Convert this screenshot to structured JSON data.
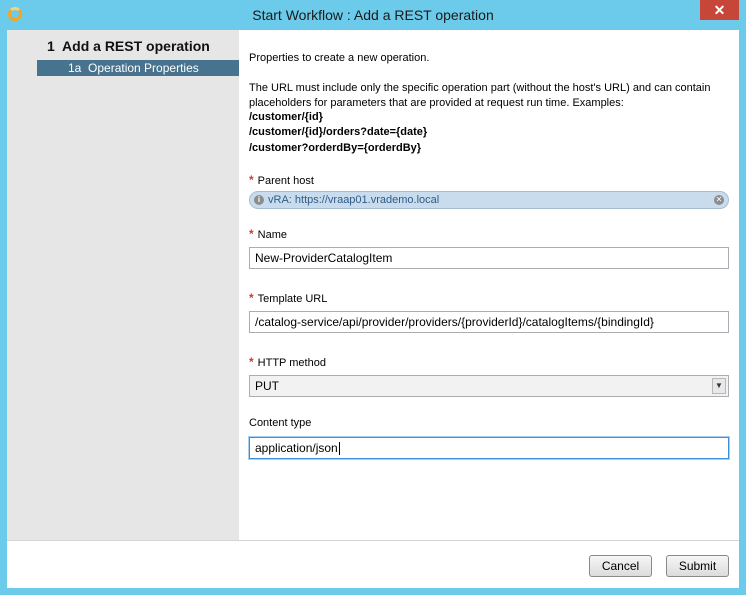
{
  "window": {
    "title": "Start Workflow : Add a REST operation",
    "close_glyph": "✕",
    "app_icon": "vro-orchestrator-icon"
  },
  "sidebar": {
    "step": "1  Add a REST operation",
    "substep": "1a  Operation Properties"
  },
  "description": {
    "intro": "Properties to create a new operation.",
    "line1": "The URL must include only the specific operation part (without the host's URL) and can contain",
    "line2": "placeholders for parameters that are provided at request run time. Examples:",
    "examples": [
      "/customer/{id}",
      "/customer/{id}/orders?date={date}",
      "/customer?orderdBy={orderdBy}"
    ]
  },
  "form": {
    "required_marker": "*",
    "parent_host": {
      "label": "Parent host",
      "value": "vRA: https://vraap01.vrademo.local"
    },
    "name": {
      "label": "Name",
      "value": "New-ProviderCatalogItem"
    },
    "template_url": {
      "label": "Template URL",
      "value": "/catalog-service/api/provider/providers/{providerId}/catalogItems/{bindingId}"
    },
    "http_method": {
      "label": "HTTP method",
      "value": "PUT"
    },
    "content_type": {
      "label": "Content type",
      "value": "application/json"
    }
  },
  "footer": {
    "cancel": "Cancel",
    "submit": "Submit"
  },
  "colors": {
    "titlebar": "#6ccbea",
    "sidebar_highlight": "#47738f",
    "required": "#d23b2e",
    "readonly_field": "#c8dced"
  }
}
